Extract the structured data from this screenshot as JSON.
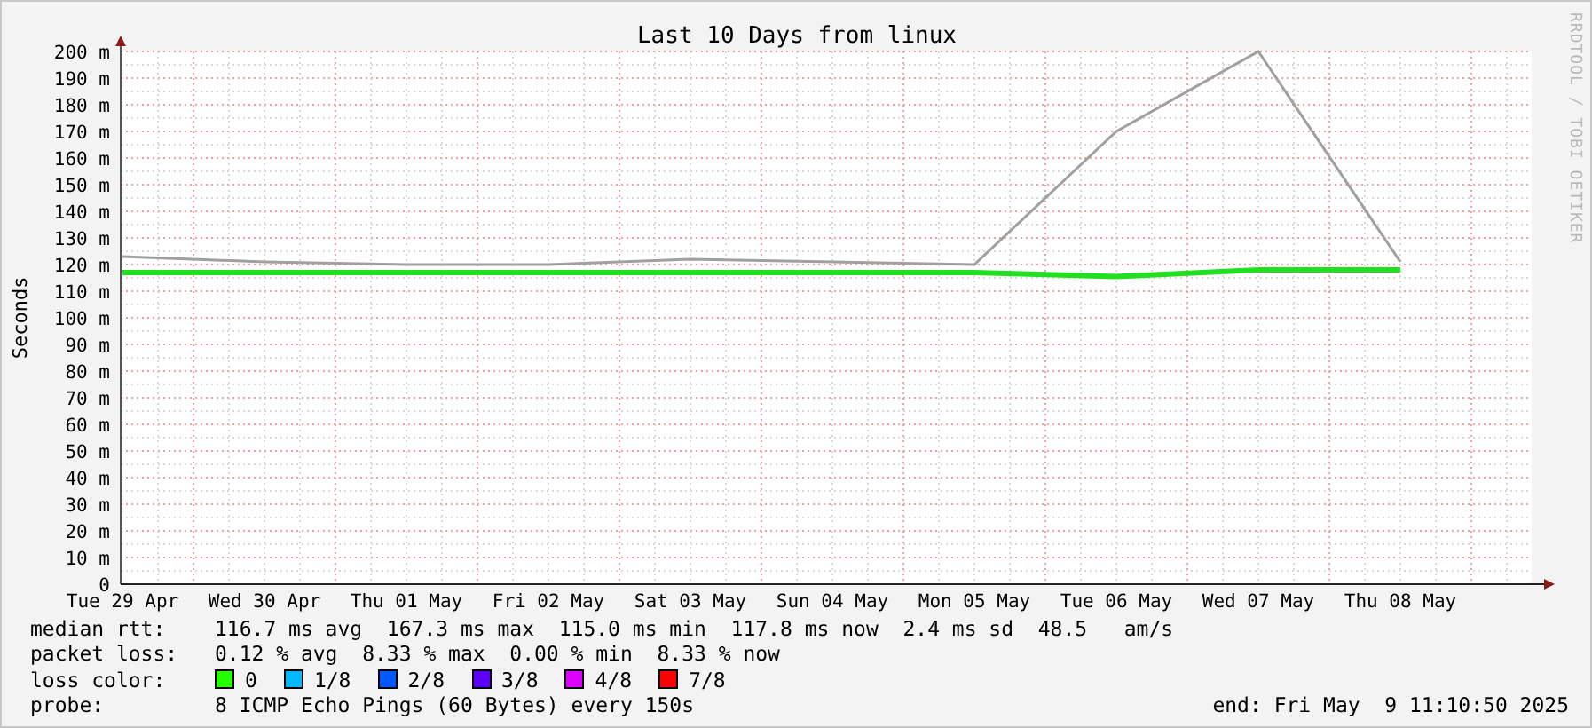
{
  "title": "Last 10 Days from linux",
  "watermark": "RRDTOOL / TOBI OETIKER",
  "chart_data": {
    "type": "line",
    "ylabel": "Seconds",
    "categories": [
      "Tue 29 Apr",
      "Wed 30 Apr",
      "Thu 01 May",
      "Fri 02 May",
      "Sat 03 May",
      "Sun 04 May",
      "Mon 05 May",
      "Tue 06 May",
      "Wed 07 May",
      "Thu 08 May"
    ],
    "series": [
      {
        "color": "#a0a0a0",
        "values": [
          123,
          121,
          120,
          120,
          122,
          121,
          120,
          170,
          200,
          121
        ]
      },
      {
        "color": "#20e020",
        "values": [
          117,
          117,
          117,
          117,
          117,
          117,
          117,
          115.5,
          118,
          118
        ]
      }
    ],
    "ylim": [
      0,
      200
    ],
    "grid": true,
    "yticks": [
      {
        "value": 0,
        "label": "0"
      },
      {
        "value": 10,
        "label": "10 m"
      },
      {
        "value": 20,
        "label": "20 m"
      },
      {
        "value": 30,
        "label": "30 m"
      },
      {
        "value": 40,
        "label": "40 m"
      },
      {
        "value": 50,
        "label": "50 m"
      },
      {
        "value": 60,
        "label": "60 m"
      },
      {
        "value": 70,
        "label": "70 m"
      },
      {
        "value": 80,
        "label": "80 m"
      },
      {
        "value": 90,
        "label": "90 m"
      },
      {
        "value": 100,
        "label": "100 m"
      },
      {
        "value": 110,
        "label": "110 m"
      },
      {
        "value": 120,
        "label": "120 m"
      },
      {
        "value": 130,
        "label": "130 m"
      },
      {
        "value": 140,
        "label": "140 m"
      },
      {
        "value": 150,
        "label": "150 m"
      },
      {
        "value": 160,
        "label": "160 m"
      },
      {
        "value": 170,
        "label": "170 m"
      },
      {
        "value": 180,
        "label": "180 m"
      },
      {
        "value": 190,
        "label": "190 m"
      },
      {
        "value": 200,
        "label": "200 m"
      }
    ]
  },
  "legend": {
    "median_rtt": {
      "label": "median rtt:",
      "text": "116.7 ms avg  167.3 ms max  115.0 ms min  117.8 ms now  2.4 ms sd  48.5   am/s"
    },
    "packet_loss": {
      "label": "packet loss:",
      "text": "0.12 % avg  8.33 % max  0.00 % min  8.33 % now"
    },
    "loss_color": {
      "label": "loss color:",
      "items": [
        {
          "text": "0",
          "color": "#26ff00"
        },
        {
          "text": "1/8",
          "color": "#00b8ff"
        },
        {
          "text": "2/8",
          "color": "#0059ff"
        },
        {
          "text": "3/8",
          "color": "#5e00ff"
        },
        {
          "text": "4/8",
          "color": "#dd00ff"
        },
        {
          "text": "7/8",
          "color": "#ff0000"
        }
      ]
    },
    "probe": {
      "label": "probe:",
      "text": "8 ICMP Echo Pings (60 Bytes) every 150s"
    },
    "end": "end: Fri May  9 11:10:50 2025"
  }
}
